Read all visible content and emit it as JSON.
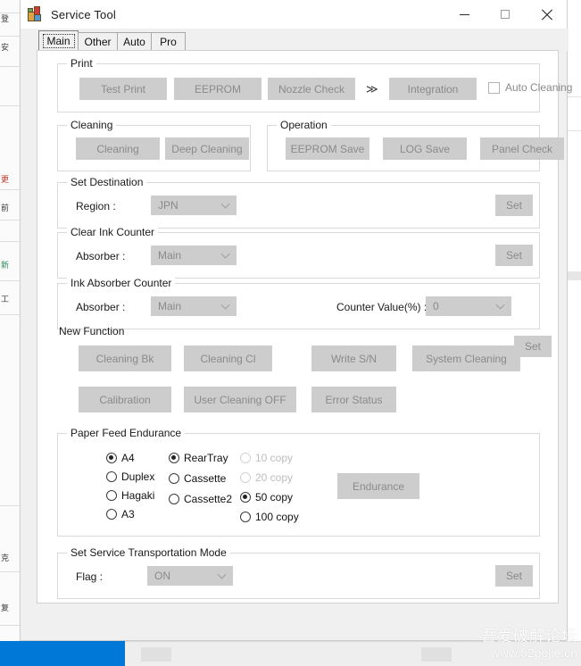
{
  "window": {
    "title": "Service Tool",
    "app_icon": "toolbox-icon",
    "controls": {
      "minimize": "minimize-icon",
      "maximize": "maximize-icon",
      "close": "close-icon"
    }
  },
  "tabs": [
    {
      "label": "Main",
      "selected": true
    },
    {
      "label": "Other",
      "selected": false
    },
    {
      "label": "Auto",
      "selected": false
    },
    {
      "label": "Pro",
      "selected": false
    }
  ],
  "print": {
    "legend": "Print",
    "buttons": [
      "Test Print",
      "EEPROM",
      "Nozzle Check",
      "Integration"
    ],
    "separator": "≫",
    "auto_cleaning": {
      "label": "Auto Cleaning",
      "checked": false
    }
  },
  "cleaning": {
    "legend": "Cleaning",
    "buttons": [
      "Cleaning",
      "Deep Cleaning"
    ]
  },
  "operation": {
    "legend": "Operation",
    "buttons": [
      "EEPROM Save",
      "LOG Save",
      "Panel Check"
    ]
  },
  "set_destination": {
    "legend": "Set Destination",
    "region_label": "Region :",
    "region_value": "JPN",
    "set_label": "Set"
  },
  "clear_ink_counter": {
    "legend": "Clear Ink Counter",
    "absorber_label": "Absorber :",
    "absorber_value": "Main",
    "set_label": "Set"
  },
  "ink_absorber_counter": {
    "legend": "Ink Absorber Counter",
    "absorber_label": "Absorber :",
    "absorber_value": "Main",
    "counter_label": "Counter Value(%) :",
    "counter_value": "0",
    "set_label": "Set"
  },
  "new_function": {
    "legend": "New Function",
    "row1": [
      "Cleaning Bk",
      "Cleaning Cl",
      "Write S/N",
      "System Cleaning"
    ],
    "row2": [
      "Calibration",
      "User Cleaning OFF",
      "Error Status"
    ]
  },
  "paper_feed_endurance": {
    "legend": "Paper Feed Endurance",
    "size_options": [
      {
        "label": "A4",
        "checked": true,
        "disabled": false
      },
      {
        "label": "Duplex",
        "checked": false,
        "disabled": false
      },
      {
        "label": "Hagaki",
        "checked": false,
        "disabled": false
      },
      {
        "label": "A3",
        "checked": false,
        "disabled": false
      }
    ],
    "source_options": [
      {
        "label": "RearTray",
        "checked": true,
        "disabled": false
      },
      {
        "label": "Cassette",
        "checked": false,
        "disabled": false
      },
      {
        "label": "Cassette2",
        "checked": false,
        "disabled": false
      }
    ],
    "copy_options": [
      {
        "label": "10 copy",
        "checked": false,
        "disabled": true
      },
      {
        "label": "20 copy",
        "checked": false,
        "disabled": true
      },
      {
        "label": "50 copy",
        "checked": true,
        "disabled": false
      },
      {
        "label": "100 copy",
        "checked": false,
        "disabled": false
      }
    ],
    "endurance_button": "Endurance"
  },
  "service_transportation": {
    "legend": "Set Service Transportation Mode",
    "flag_label": "Flag :",
    "flag_value": "ON",
    "set_label": "Set"
  },
  "watermark": {
    "line1": "吾爱破解论坛",
    "line2": "www.52pojie.cn"
  }
}
